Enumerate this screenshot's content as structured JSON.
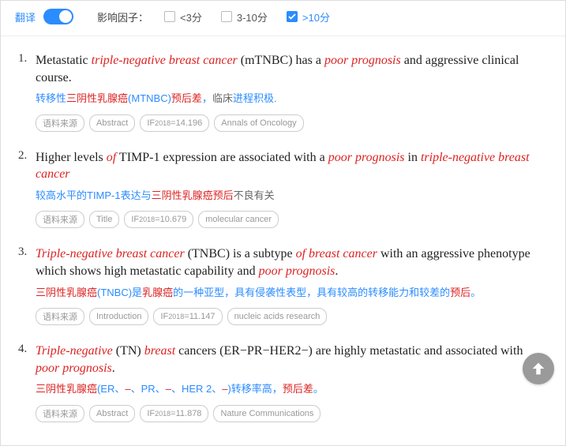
{
  "topbar": {
    "translate_label": "翻译",
    "filter_label": "影响因子：",
    "options": [
      {
        "label": "<3分",
        "checked": false
      },
      {
        "label": "3-10分",
        "checked": false
      },
      {
        "label": ">10分",
        "checked": true
      }
    ]
  },
  "tag_labels": {
    "source": "语料来源",
    "if_prefix": "IF",
    "if_year": "2018"
  },
  "results": [
    {
      "num": "1.",
      "en_html": "Metastatic <em>triple-negative breast cancer</em> (mTNBC) has a <em>poor prognosis</em> and aggressive clinical course.",
      "zh_html": "转移性<span class='r'>三阴性乳腺癌</span>(MTNBC)<span class='r'>预后差</span>，<span class='g'>临床</span>进程积极.",
      "section": "Abstract",
      "if": "14.196",
      "journal": "Annals of Oncology"
    },
    {
      "num": "2.",
      "en_html": "Higher levels <em>of</em> TIMP-1 expression are associated with a <em>poor prognosis</em> in <em>triple-negative breast cancer</em>",
      "zh_html": "较高水平的TIMP-1表达与<span class='r'>三阴性乳腺癌预后</span><span class='g'>不良有关</span>",
      "section": "Title",
      "if": "10.679",
      "journal": "molecular cancer"
    },
    {
      "num": "3.",
      "en_html": "<em>Triple-negative breast cancer</em> (TNBC) is a subtype <em>of breast cancer</em> with an aggressive phenotype which shows high metastatic capability and <em>poor prognosis</em>.",
      "zh_html": "<span class='r'>三阴性乳腺癌</span>(TNBC)是<span class='r'>乳腺癌</span>的一种亚型，具有侵袭性表型，具有较高的转移能力和较差的<span class='r'>预后</span>。",
      "section": "Introduction",
      "if": "11.147",
      "journal": "nucleic acids research"
    },
    {
      "num": "4.",
      "en_html": "<em>Triple-negative</em> (TN) <em>breast</em> cancers (ER−PR−HER2−) are highly metastatic and associated with <em>poor prognosis</em>.",
      "zh_html": "<span class='r'>三阴性乳腺癌</span>(ER、<span class='r'>–</span>、PR、<span class='r'>–</span>、HER 2、<span class='r'>–</span>)转移率高，<span class='r'>预后差</span>。",
      "section": "Abstract",
      "if": "11.878",
      "journal": "Nature Communications"
    }
  ]
}
